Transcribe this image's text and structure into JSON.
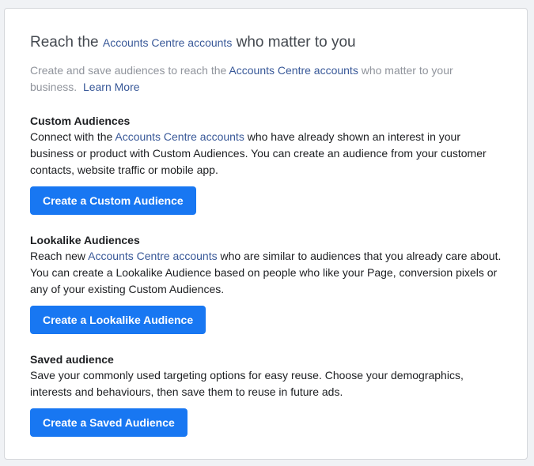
{
  "header": {
    "title_prefix": "Reach the ",
    "title_link": "Accounts Centre accounts",
    "title_suffix": " who matter to you"
  },
  "intro": {
    "text_prefix": "Create and save audiences to reach the ",
    "text_link": "Accounts Centre accounts",
    "text_suffix": " who matter to your business.",
    "learn_more": "Learn More"
  },
  "sections": [
    {
      "title": "Custom Audiences",
      "text_prefix": "Connect with the ",
      "text_link": "Accounts Centre accounts",
      "text_suffix": " who have already shown an interest in your business or product with Custom Audiences. You can create an audience from your customer contacts, website traffic or mobile app.",
      "button": "Create a Custom Audience"
    },
    {
      "title": "Lookalike Audiences",
      "text_prefix": "Reach new ",
      "text_link": "Accounts Centre accounts",
      "text_suffix": " who are similar to audiences that you already care about. You can create a Lookalike Audience based on people who like your Page, conversion pixels or any of your existing Custom Audiences.",
      "button": "Create a Lookalike Audience"
    },
    {
      "title": "Saved audience",
      "text": "Save your commonly used targeting options for easy reuse. Choose your demographics, interests and behaviours, then save them to reuse in future ads.",
      "button": "Create a Saved Audience"
    }
  ],
  "colors": {
    "primary_button": "#1877f2",
    "link": "#385898"
  }
}
